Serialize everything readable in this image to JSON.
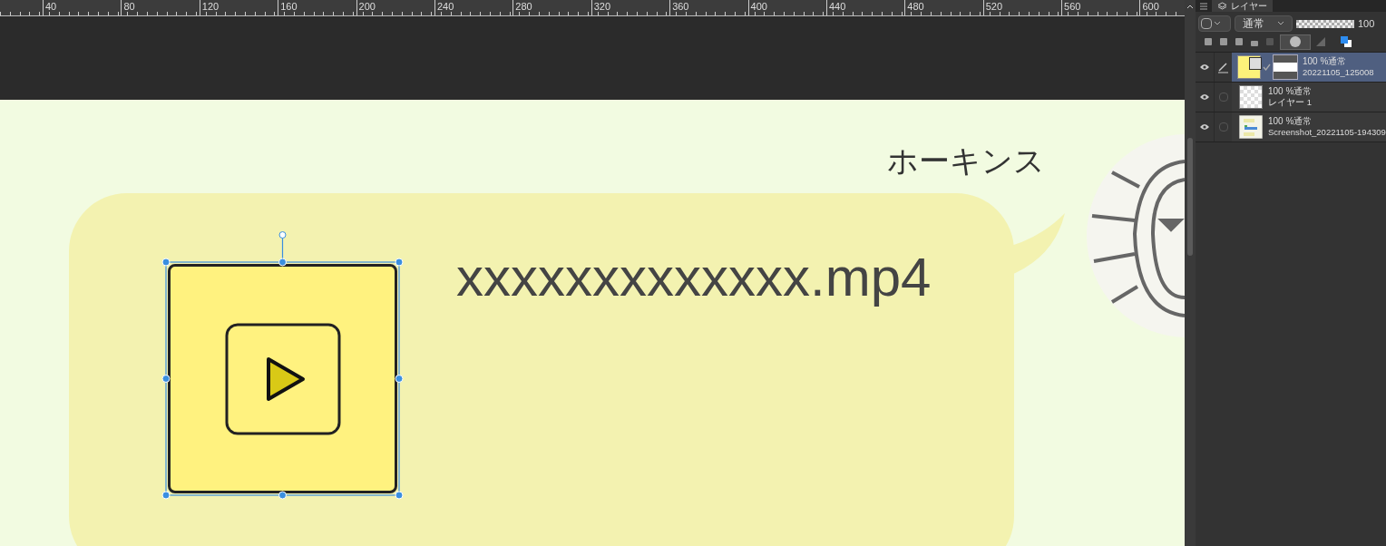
{
  "ruler": {
    "labels": [
      "40",
      "80",
      "120",
      "160",
      "200",
      "240",
      "280",
      "320",
      "360",
      "400",
      "440",
      "480",
      "520",
      "560",
      "600"
    ]
  },
  "canvas": {
    "speaker_name": "ホーキンス",
    "file_name": "xxxxxxxxxxxxx.mp4"
  },
  "layer_panel": {
    "tab": "レイヤー",
    "blend_mode": "通常",
    "opacity": "100",
    "opacity_slider": {
      "level": 1
    },
    "layers": [
      {
        "mode": "100 %通常",
        "name": "20221105_125008",
        "visible": true,
        "drawing_target": true,
        "selected": true,
        "kind": "masked"
      },
      {
        "mode": "100 %通常",
        "name": "レイヤー 1",
        "visible": true,
        "drawing_target": false,
        "selected": false,
        "kind": "transparent"
      },
      {
        "mode": "100 %通常",
        "name": "Screenshot_20221105-194309",
        "visible": true,
        "drawing_target": false,
        "selected": false
      }
    ]
  }
}
